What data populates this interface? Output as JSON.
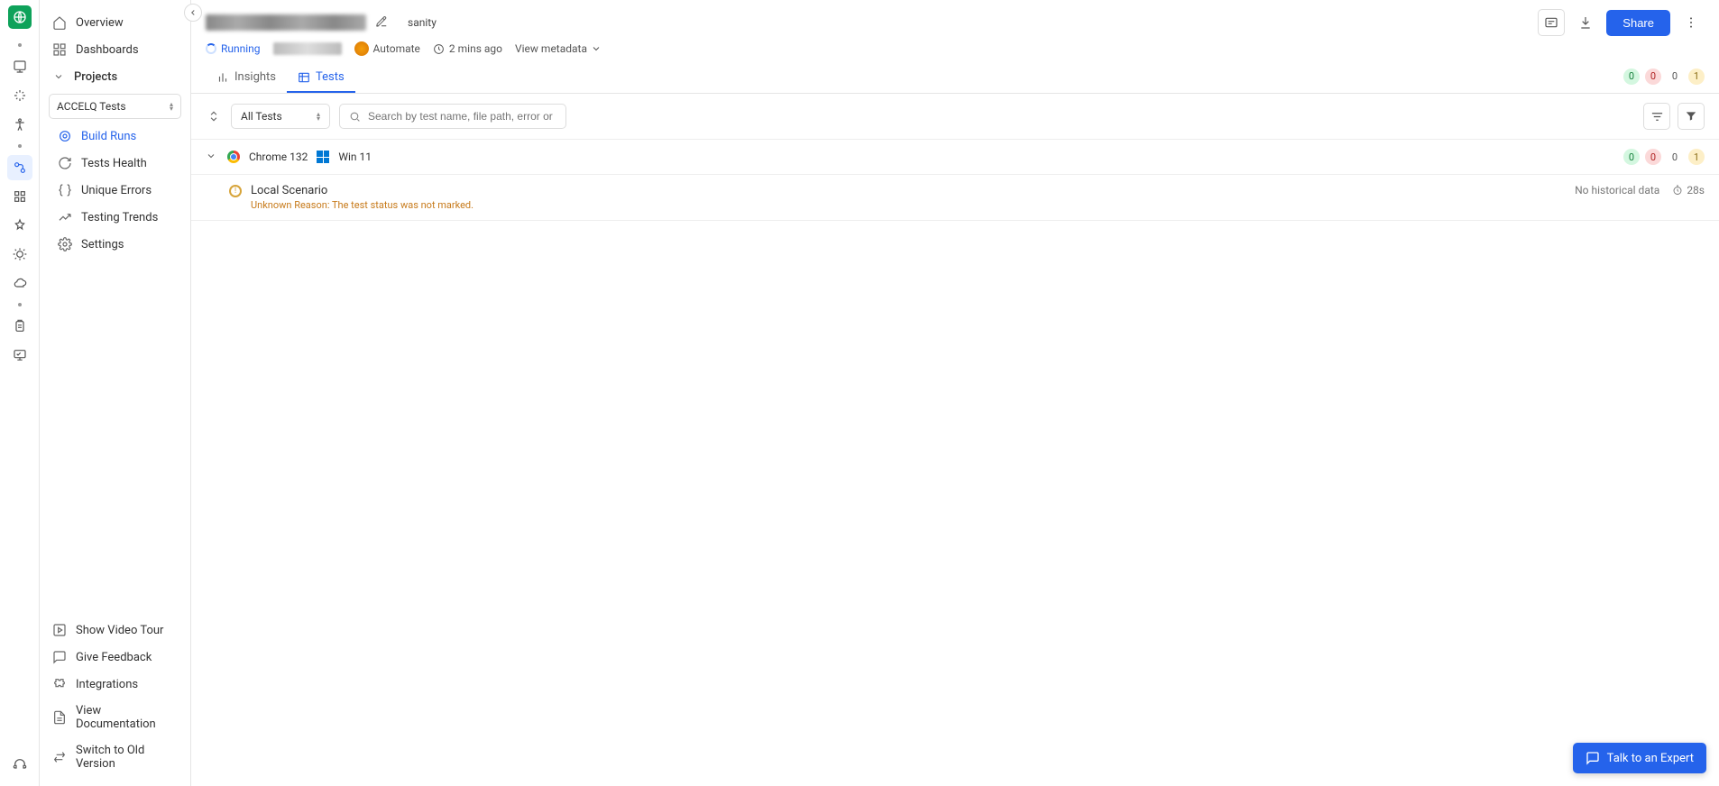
{
  "sidebar": {
    "overview": "Overview",
    "dashboards": "Dashboards",
    "projects": "Projects",
    "project_selected": "ACCELQ Tests",
    "build_runs": "Build Runs",
    "tests_health": "Tests Health",
    "unique_errors": "Unique Errors",
    "testing_trends": "Testing Trends",
    "settings": "Settings",
    "video_tour": "Show Video Tour",
    "give_feedback": "Give Feedback",
    "integrations": "Integrations",
    "view_docs": "View Documentation",
    "switch_old": "Switch to Old Version"
  },
  "header": {
    "tag": "sanity",
    "status": "Running",
    "automate": "Automate",
    "time_ago": "2 mins ago",
    "view_metadata": "View metadata",
    "share": "Share"
  },
  "tabs": {
    "insights": "Insights",
    "tests": "Tests",
    "counts": {
      "pass": "0",
      "fail": "0",
      "skip": "0",
      "unknown": "1"
    }
  },
  "filters": {
    "all_tests": "All Tests",
    "search_placeholder": "Search by test name, file path, error or BrowserSt"
  },
  "group": {
    "browser": "Chrome 132",
    "os": "Win 11",
    "counts": {
      "pass": "0",
      "fail": "0",
      "skip": "0",
      "unknown": "1"
    }
  },
  "test": {
    "name": "Local Scenario",
    "error": "Unknown Reason: The test status was not marked.",
    "history": "No historical data",
    "duration": "28s"
  },
  "chat": "Talk to an Expert"
}
